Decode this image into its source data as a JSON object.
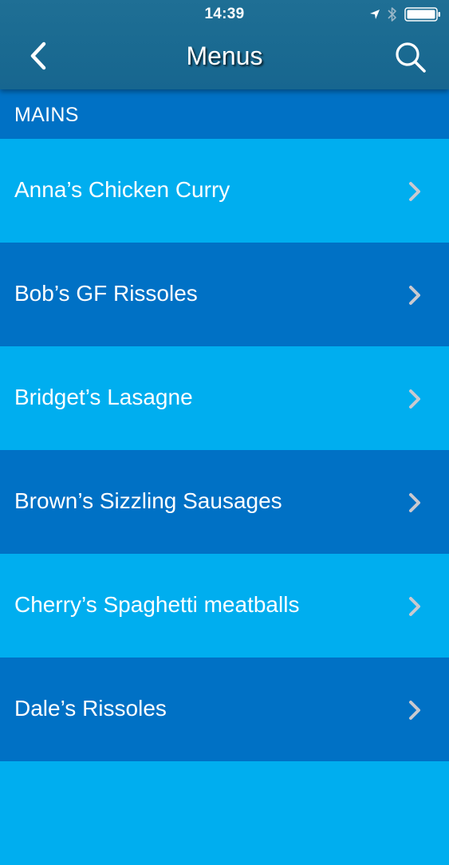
{
  "status_bar": {
    "time": "14:39",
    "icons": [
      "location-arrow-icon",
      "bluetooth-icon",
      "battery-icon"
    ]
  },
  "nav_bar": {
    "title": "Menus",
    "back_icon": "chevron-left-icon",
    "search_icon": "search-icon"
  },
  "section": {
    "title": "MAINS"
  },
  "menu_items": [
    {
      "label": "Anna’s Chicken Curry"
    },
    {
      "label": "Bob’s GF Rissoles"
    },
    {
      "label": "Bridget’s Lasagne"
    },
    {
      "label": "Brown’s Sizzling Sausages"
    },
    {
      "label": "Cherry’s Spaghetti meatballs"
    },
    {
      "label": "Dale’s Rissoles"
    },
    {
      "label": ""
    }
  ],
  "colors": {
    "nav_bar": "#1a6a91",
    "row_light": "#00aeef",
    "row_dark": "#0071c5",
    "chevron": "#c9c9cf",
    "text": "#ffffff"
  }
}
